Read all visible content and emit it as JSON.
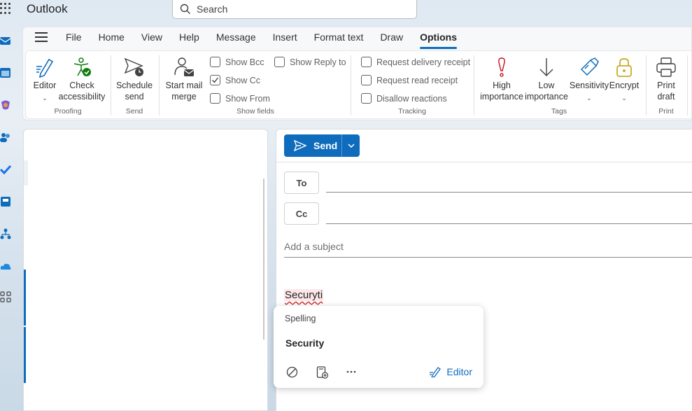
{
  "titlebar": {
    "app_title": "Outlook",
    "search_placeholder": "Search"
  },
  "menu": {
    "tabs": [
      {
        "label": "File"
      },
      {
        "label": "Home"
      },
      {
        "label": "View"
      },
      {
        "label": "Help"
      },
      {
        "label": "Message"
      },
      {
        "label": "Insert"
      },
      {
        "label": "Format text"
      },
      {
        "label": "Draw"
      },
      {
        "label": "Options",
        "active": true
      }
    ]
  },
  "ribbon": {
    "editor": "Editor",
    "check_accessibility_1": "Check",
    "check_accessibility_2": "accessibility",
    "proofing": "Proofing",
    "schedule_send_1": "Schedule",
    "schedule_send_2": "send",
    "send_group": "Send",
    "start_mail_merge_1": "Start mail",
    "start_mail_merge_2": "merge",
    "show_bcc": "Show Bcc",
    "show_cc": "Show Cc",
    "show_from": "Show From",
    "show_reply_to": "Show Reply to",
    "show_fields": "Show fields",
    "request_delivery": "Request delivery receipt",
    "request_read": "Request read receipt",
    "disallow_reactions": "Disallow reactions",
    "tracking": "Tracking",
    "high_importance_1": "High",
    "high_importance_2": "importance",
    "low_importance_1": "Low",
    "low_importance_2": "importance",
    "sensitivity": "Sensitivity",
    "encrypt": "Encrypt",
    "tags": "Tags",
    "print_draft_1": "Print",
    "print_draft_2": "draft",
    "print_group": "Print"
  },
  "compose": {
    "send_label": "Send",
    "to_label": "To",
    "cc_label": "Cc",
    "subject_placeholder": "Add a subject",
    "body_text": "Securyti"
  },
  "spelling_popup": {
    "title": "Spelling",
    "suggestion": "Security",
    "editor_label": "Editor"
  },
  "colors": {
    "accent": "#0f6cbd",
    "misspelling": "#d13438"
  }
}
